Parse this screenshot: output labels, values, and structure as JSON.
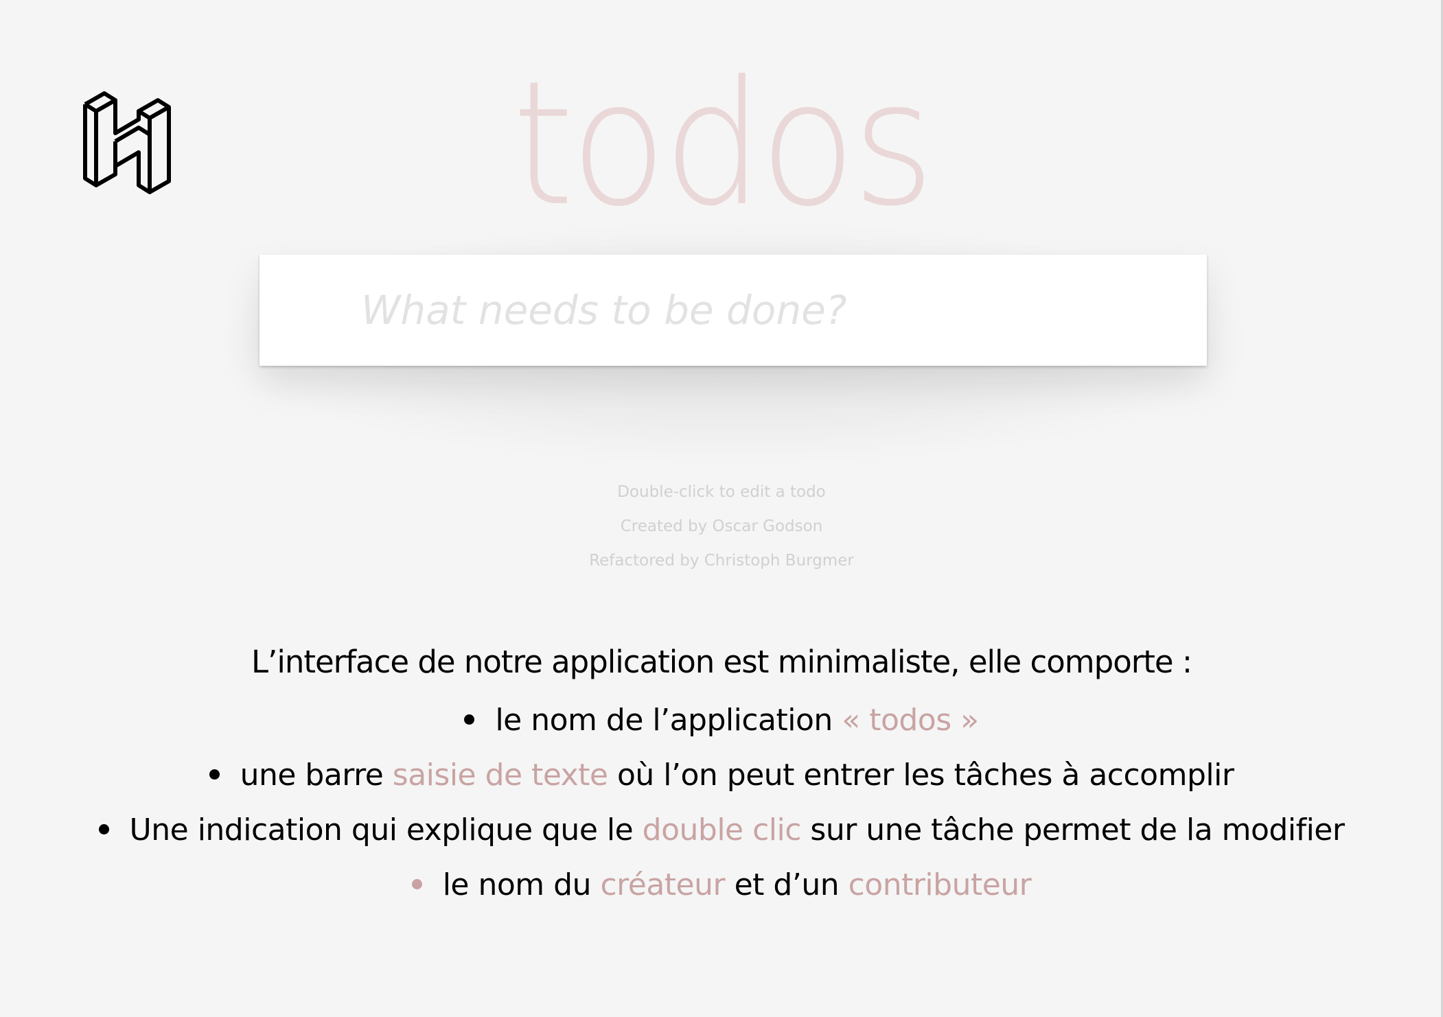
{
  "header": {
    "logo_icon": "h-isometric-logo-icon",
    "app_title": "todos"
  },
  "input": {
    "placeholder": "What needs to be done?"
  },
  "info": {
    "line1": "Double-click to edit a todo",
    "line2": "Created by Oscar Godson",
    "line3": "Refactored by Christoph Burgmer"
  },
  "description": {
    "heading": "L’interface de notre application est minimaliste, elle comporte :",
    "items": [
      {
        "parts": [
          "le nom de l’application ",
          "« todos »",
          ""
        ]
      },
      {
        "parts": [
          "une barre ",
          "saisie de texte",
          " où l’on peut entrer les tâches à accomplir"
        ]
      },
      {
        "parts": [
          "Une indication qui explique que le ",
          "double clic",
          " sur une tâche permet de la modifier"
        ]
      },
      {
        "parts": [
          "le nom du ",
          "créateur",
          " et d’un ",
          "contributeur"
        ]
      }
    ]
  },
  "colors": {
    "background": "#f5f5f5",
    "title": "#eadada",
    "highlight": "#c9a3a3"
  }
}
